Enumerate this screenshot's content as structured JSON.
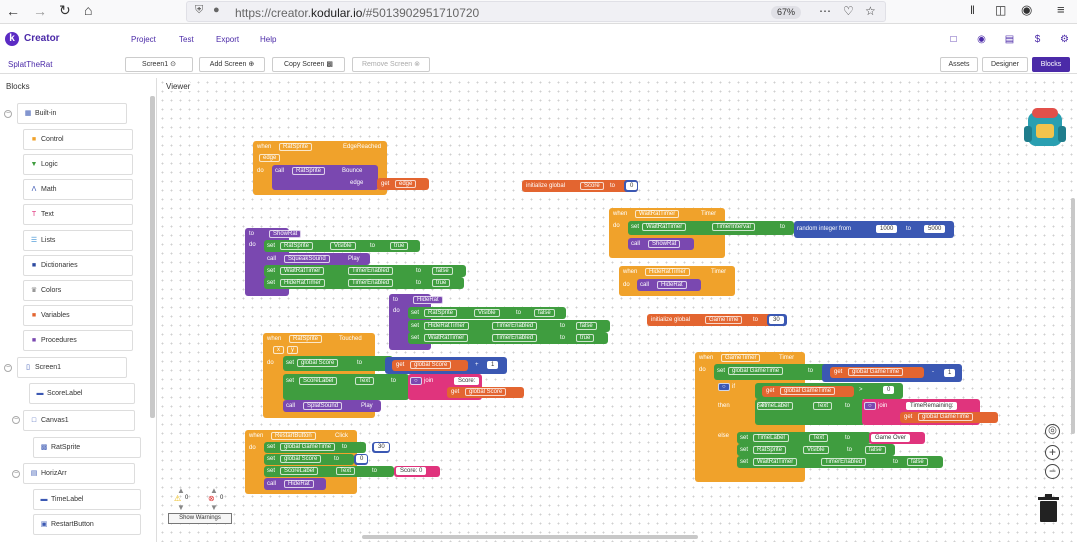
{
  "browser": {
    "url_prefix": "https://creator.",
    "url_host": "kodular.io",
    "url_rest": "/#5013902951710720",
    "zoom": "67%"
  },
  "app": {
    "logo": "k",
    "brand": "Creator",
    "menu": [
      "Project",
      "Test",
      "Export",
      "Help"
    ]
  },
  "project": {
    "name": "SplatTheRat",
    "screen": "Screen1",
    "add_screen": "Add Screen",
    "copy_screen": "Copy Screen",
    "remove_screen": "Remove Screen",
    "tabs": [
      "Assets",
      "Designer",
      "Blocks"
    ],
    "active_tab": "Blocks"
  },
  "blocks_panel": {
    "title": "Blocks",
    "builtin_label": "Built-in",
    "builtin": [
      "Control",
      "Logic",
      "Math",
      "Text",
      "Lists",
      "Dictionaries",
      "Colors",
      "Variables",
      "Procedures"
    ],
    "screen": "Screen1",
    "components": [
      "ScoreLabel",
      "Canvas1",
      "RatSprite",
      "HorizArr",
      "TimeLabel",
      "RestartButton"
    ]
  },
  "viewer": {
    "title": "Viewer",
    "show_warnings": "Show Warnings",
    "warnings": "0",
    "errors": "0"
  },
  "blocks": {
    "edge": {
      "when": "when",
      "comp": "RatSprite",
      "evt": "EdgeReached",
      "param": "edge",
      "do": "do",
      "call": "call",
      "comp2": "RatSprite",
      "method": "Bounce",
      "arg": "edge",
      "get": "get",
      "var": "edge"
    },
    "initscore": {
      "init": "initialize global",
      "name": "Score",
      "to": "to",
      "val": "0"
    },
    "wrt": {
      "when": "when",
      "comp": "WaitRatTimer",
      "evt": "Timer",
      "do": "do",
      "set": "set",
      "comp2": "WaitRatTimer",
      "prop": "TimerInterval",
      "to": "to",
      "rand": "random integer from",
      "from": "1000",
      "to2": "to",
      "upto": "5000",
      "call": "call",
      "proc": "ShowRat"
    },
    "hrt": {
      "when": "when",
      "comp": "HideRatTimer",
      "evt": "Timer",
      "do": "do",
      "call": "call",
      "proc": "HideRat"
    },
    "showrat": {
      "to": "to",
      "name": "ShowRat",
      "do": "do",
      "rows": [
        [
          "set",
          "RatSprite",
          "Visible",
          "to",
          "true"
        ],
        [
          "call",
          "SqueakSound",
          "Play",
          "",
          ""
        ],
        [
          "set",
          "WaitRatTimer",
          "TimerEnabled",
          "to",
          "false"
        ],
        [
          "set",
          "HideRatTimer",
          "TimerEnabled",
          "to",
          "true"
        ]
      ]
    },
    "hiderat": {
      "to": "to",
      "name": "HideRat",
      "do": "do",
      "rows": [
        [
          "set",
          "RatSprite",
          "Visible",
          "to",
          "false"
        ],
        [
          "set",
          "HideRatTimer",
          "TimerEnabled",
          "to",
          "false"
        ],
        [
          "set",
          "WaitRatTimer",
          "TimerEnabled",
          "to",
          "true"
        ]
      ]
    },
    "inittime": {
      "init": "initialize global",
      "name": "GameTime",
      "to": "to",
      "val": "30"
    },
    "touched": {
      "when": "when",
      "comp": "RatSprite",
      "evt": "Touched",
      "x": "x",
      "y": "y",
      "do": "do",
      "set": "set",
      "var": "global Score",
      "to": "to",
      "get": "get",
      "var2": "global Score",
      "plus": "+",
      "one": "1",
      "set2": "set",
      "comp2": "ScoreLabel",
      "prop": "Text",
      "to2": "to",
      "join": "join",
      "str": "Score: ",
      "get2": "get",
      "var3": "global Score",
      "call": "call",
      "sound": "SplatSound",
      "play": "Play"
    },
    "restart": {
      "when": "when",
      "comp": "RestartButton",
      "evt": "Click",
      "do": "do",
      "rows": [
        [
          "set",
          "global GameTime",
          "to",
          "30"
        ],
        [
          "set",
          "global Score",
          "to",
          "0"
        ],
        [
          "set",
          "ScoreLabel",
          "Text",
          "to",
          "Score: 0"
        ]
      ],
      "call": "call",
      "proc": "HideRat"
    },
    "game": {
      "when": "when",
      "comp": "GameTimer",
      "evt": "Timer",
      "do": "do",
      "set": "set",
      "var": "global GameTime",
      "to": "to",
      "get": "get",
      "var2": "global GameTime",
      "minus": "-",
      "one": "1",
      "if": "if",
      "get2": "get",
      "var3": "global GameTime",
      "gt": ">",
      "zero": "0",
      "then": "then",
      "set2": "set",
      "comp2": "TimeLabel",
      "prop": "Text",
      "to2": "to",
      "join": "join",
      "str": "TimeRemaining: ",
      "get3": "get",
      "var4": "global GameTime",
      "else": "else",
      "erows": [
        [
          "set",
          "TimeLabel",
          "Text",
          "to",
          "Game Over"
        ],
        [
          "set",
          "RatSprite",
          "Visible",
          "to",
          "false"
        ],
        [
          "set",
          "WaitRatTimer",
          "TimerEnabled",
          "to",
          "false"
        ]
      ]
    }
  }
}
